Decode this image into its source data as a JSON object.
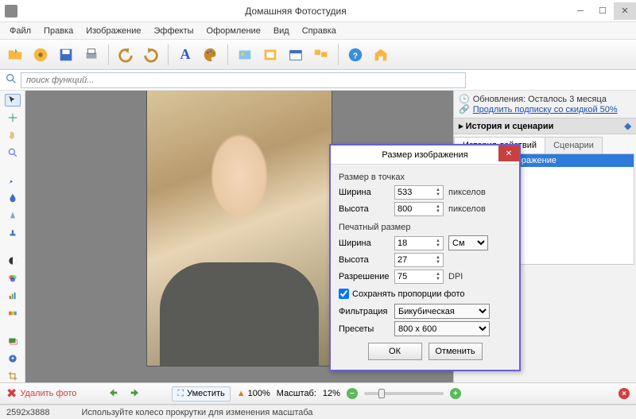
{
  "app": {
    "title": "Домашняя Фотостудия"
  },
  "menu": [
    "Файл",
    "Правка",
    "Изображение",
    "Эффекты",
    "Оформление",
    "Вид",
    "Справка"
  ],
  "toolbar_icons": [
    "open-folder",
    "lightbulb",
    "save",
    "print",
    "separator",
    "undo",
    "redo",
    "separator",
    "text-tool",
    "palette",
    "separator",
    "image-effect",
    "frame",
    "calendar",
    "layers",
    "separator",
    "help",
    "home"
  ],
  "search": {
    "placeholder": "поиск функций..."
  },
  "tools": [
    "pointer",
    "move",
    "hand",
    "magnifier",
    "brush",
    "droplet",
    "blur",
    "stamp",
    "contrast",
    "rgb",
    "levels",
    "gradient",
    "adjust",
    "fx",
    "crop"
  ],
  "update": {
    "line1": "Обновления: Осталось  3 месяца",
    "link": "Продлить подписку со скидкой 50%"
  },
  "history": {
    "header": "История и сценарии",
    "tab1": "История действий",
    "tab2": "Сценарии",
    "item": "Исходное изображение"
  },
  "bottom": {
    "delete": "Удалить фото",
    "fit": "Уместить",
    "hundred": "100%",
    "scale_label": "Масштаб:",
    "scale_value": "12%"
  },
  "status": {
    "dims": "2592x3888",
    "hint": "Используйте колесо прокрутки для изменения масштаба"
  },
  "dialog": {
    "title": "Размер изображения",
    "px_group": "Размер в точках",
    "width_label": "Ширина",
    "width_val": "533",
    "height_label": "Высота",
    "height_val": "800",
    "px_unit": "пикселов",
    "print_group": "Печатный размер",
    "print_w": "18",
    "print_h": "27",
    "cm_unit": "См",
    "res_label": "Разрешение",
    "res_val": "75",
    "dpi": "DPI",
    "keep_ratio": "Сохранять пропорции фото",
    "filter_label": "Фильтрация",
    "filter_val": "Бикубическая",
    "preset_label": "Пресеты",
    "preset_val": "800 x 600",
    "ok": "ОК",
    "cancel": "Отменить"
  }
}
